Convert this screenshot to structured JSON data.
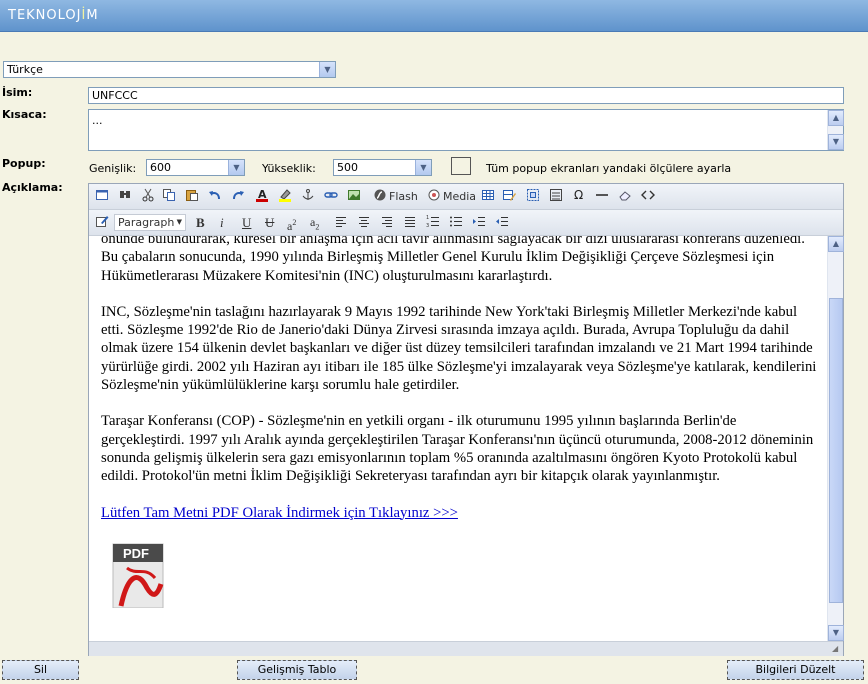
{
  "app": {
    "logo_main": "TEKNOLOJ",
    "logo_accent": "İ",
    "logo_end": "M"
  },
  "language_select": {
    "value": "Türkçe"
  },
  "fields": {
    "name_label": "İsim:",
    "name_value": "UNFCCC",
    "short_label": "Kısaca:",
    "short_value": "...",
    "popup_label": "Popup:",
    "width_label": "Genişlik:",
    "width_value": "600",
    "height_label": "Yükseklik:",
    "height_value": "500",
    "apply_all_label": "Tüm popup ekranları yandaki ölçülere ayarla",
    "desc_label": "Açıklama:"
  },
  "toolbar": {
    "flash_label": "Flash",
    "media_label": "Media",
    "format_value": "Paragraph"
  },
  "content": {
    "paragraphs": [
      "önünde bulundurarak, küresel bir anlaşma için acil tavır alınmasını sağlayacak bir dizi uluslararası konferans düzenledi. Bu çabaların sonucunda, 1990 yılında Birleşmiş Milletler Genel Kurulu İklim Değişikliği Çerçeve Sözleşmesi için Hükümetlerarası Müzakere Komitesi'nin (INC) oluşturulmasını kararlaştırdı.",
      "INC, Sözleşme'nin taslağını hazırlayarak 9 Mayıs 1992 tarihinde New York'taki Birleşmiş Milletler Merkezi'nde kabul etti. Sözleşme 1992'de Rio de Janerio'daki Dünya Zirvesi sırasında imzaya açıldı. Burada, Avrupa Topluluğu da dahil olmak üzere 154 ülkenin devlet başkanları ve diğer üst düzey temsilcileri tarafından imzalandı ve 21 Mart 1994 tarihinde yürürlüğe girdi. 2002 yılı Haziran ayı itibarı ile 185 ülke Sözleşme'yi imzalayarak veya Sözleşme'ye katılarak, kendilerini Sözleşme'nin yükümlülüklerine karşı sorumlu hale getirdiler.",
      "Taraşar Konferansı (COP) - Sözleşme'nin en yetkili organı - ilk oturumunu 1995 yılının başlarında Berlin'de gerçekleştirdi. 1997 yılı Aralık ayında gerçekleştirilen Taraşar Konferansı'nın üçüncü oturumunda, 2008-2012 döneminin sonunda gelişmiş ülkelerin sera gazı emisyonlarının toplam %5 oranında azaltılmasını öngören Kyoto Protokolü kabul edildi. Protokol'ün metni İklim Değişikliği Sekreteryası tarafından ayrı bir kitapçık olarak yayınlanmıştır."
    ],
    "link_text": "Lütfen Tam Metni PDF Olarak İndirmek için Tıklayınız >>>",
    "pdf_icon_text": "PDF"
  },
  "buttons": {
    "delete": "Sil",
    "advanced_table": "Gelişmiş Tablo",
    "update": "Bilgileri Düzelt"
  }
}
